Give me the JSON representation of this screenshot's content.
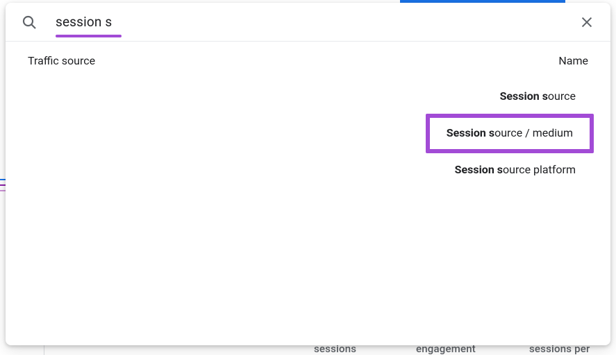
{
  "search": {
    "value": "session s",
    "placeholder": ""
  },
  "headers": {
    "left": "Traffic source",
    "right": "Name"
  },
  "results": [
    {
      "bold": "Session s",
      "rest": "ource"
    },
    {
      "bold": "Session s",
      "rest": "ource / medium"
    },
    {
      "bold": "Session s",
      "rest": "ource platform"
    }
  ],
  "bg": {
    "w1": "sessions",
    "w2": "engagement",
    "w3": "sessions per"
  }
}
